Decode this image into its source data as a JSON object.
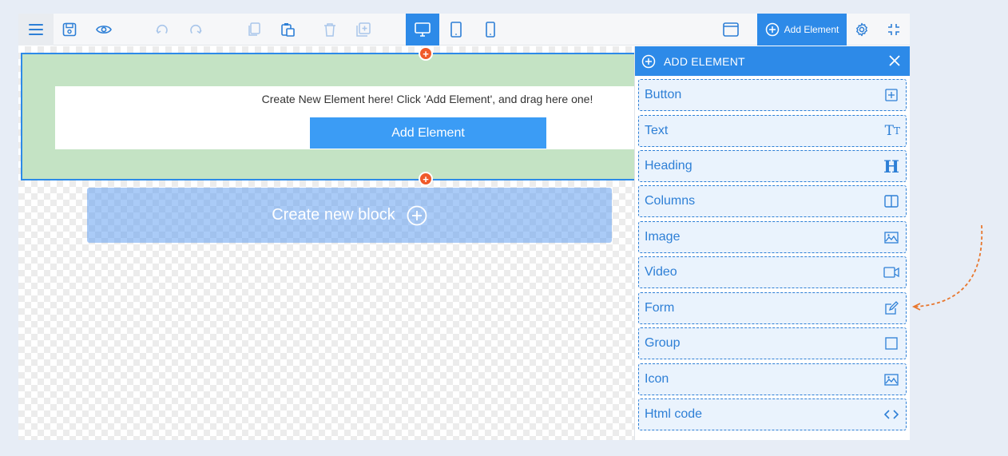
{
  "toolbar": {
    "add_element_label": "Add Element",
    "icons": [
      "menu-icon",
      "save-icon",
      "preview-icon",
      "undo-icon",
      "redo-icon",
      "copy-icon",
      "paste-icon",
      "delete-icon",
      "duplicate-icon",
      "desktop-icon",
      "tablet-icon",
      "mobile-icon",
      "fullwidth-icon",
      "add-circle-icon",
      "settings-icon",
      "collapse-icon"
    ],
    "active_device": "desktop"
  },
  "canvas": {
    "hint": "Create New Element here! Click 'Add Element', and drag here one!",
    "add_element_button": "Add Element",
    "new_block_label": "Create new block"
  },
  "panel": {
    "title": "ADD ELEMENT",
    "items": [
      {
        "label": "Button",
        "icon": "button-plus-icon"
      },
      {
        "label": "Text",
        "icon": "text-icon"
      },
      {
        "label": "Heading",
        "icon": "heading-icon"
      },
      {
        "label": "Columns",
        "icon": "columns-icon"
      },
      {
        "label": "Image",
        "icon": "image-icon"
      },
      {
        "label": "Video",
        "icon": "video-icon"
      },
      {
        "label": "Form",
        "icon": "form-edit-icon"
      },
      {
        "label": "Group",
        "icon": "group-square-icon"
      },
      {
        "label": "Icon",
        "icon": "icon-image-icon"
      },
      {
        "label": "Html code",
        "icon": "code-icon"
      }
    ]
  },
  "colors": {
    "accent": "#2d8ae8",
    "block_green": "#c4e3c4",
    "marker_orange": "#f05a2a",
    "arrow_orange": "#e8772e"
  }
}
